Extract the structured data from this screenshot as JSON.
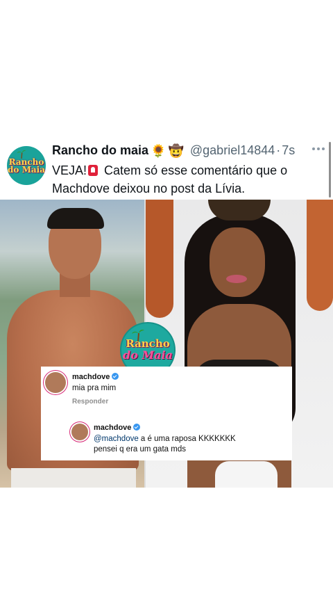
{
  "post": {
    "display_name": "Rancho do maia",
    "name_emojis": [
      "🌻",
      "🤠"
    ],
    "handle": "@gabriel14844",
    "separator": "·",
    "time": "7s",
    "text_before": "VEJA!",
    "text_after": "Catem só esse comentário que o Machdove deixou no post da Lívia.",
    "avatar_logo_line1": "Rancho",
    "avatar_logo_line2": "do Maia"
  },
  "media": {
    "badge_line1": "Rancho",
    "badge_line2": "do Maia",
    "comment": {
      "username": "machdove",
      "text": "mia pra mim",
      "reply_label": "Responder"
    },
    "reply": {
      "username": "machdove",
      "mention": "@machdove",
      "text": " a é uma raposa KKKKKKK pensei q era um gata mds"
    }
  },
  "colors": {
    "brand_teal": "#1aa39a",
    "handle_gray": "#536471",
    "verified_blue": "#3897f0"
  }
}
